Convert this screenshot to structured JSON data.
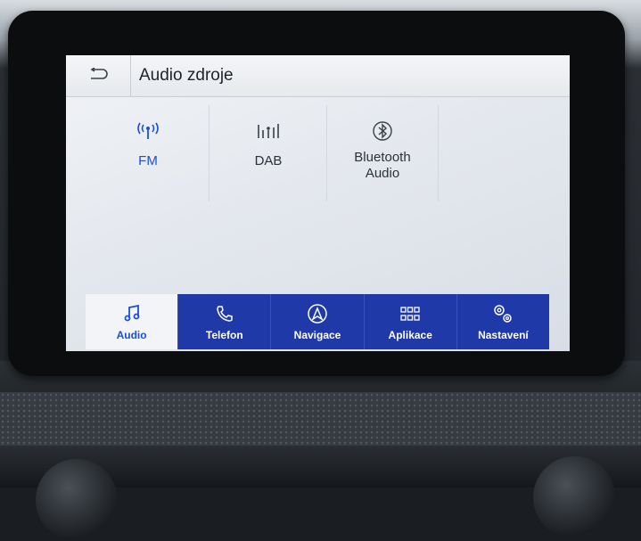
{
  "header": {
    "title": "Audio zdroje",
    "back_icon": "back-arrow-icon"
  },
  "sources": [
    {
      "label": "FM",
      "icon": "radio-antenna-icon",
      "selected": true
    },
    {
      "label": "DAB",
      "icon": "dab-antenna-icon",
      "selected": false
    },
    {
      "label": "Bluetooth Audio",
      "icon": "bluetooth-icon",
      "selected": false
    }
  ],
  "nav": [
    {
      "label": "Audio",
      "icon": "music-note-icon",
      "active": true
    },
    {
      "label": "Telefon",
      "icon": "phone-icon",
      "active": false
    },
    {
      "label": "Navigace",
      "icon": "navigation-icon",
      "active": false
    },
    {
      "label": "Aplikace",
      "icon": "apps-grid-icon",
      "active": false
    },
    {
      "label": "Nastavení",
      "icon": "settings-gears-icon",
      "active": false
    }
  ],
  "colors": {
    "accent": "#1b4fd6",
    "nav_bg": "#1f3aa8"
  }
}
